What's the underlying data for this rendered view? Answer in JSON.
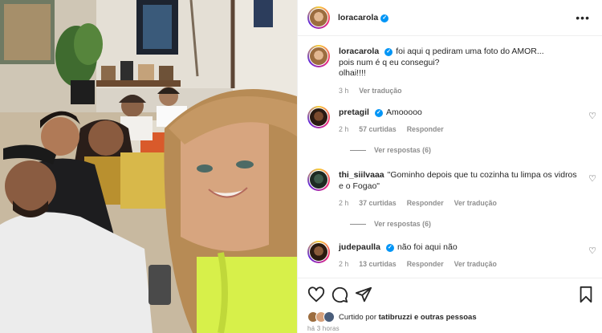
{
  "post": {
    "username": "loracarola",
    "caption": {
      "line1": "foi aqui q pediram uma foto do AMOR...",
      "line2": "pois num é q eu consegui?",
      "line3": "olhai!!!!",
      "time": "3 h",
      "translate": "Ver tradução"
    }
  },
  "comments": [
    {
      "username": "pretagil",
      "text": "Amooooo",
      "time": "2 h",
      "likes": "57 curtidas",
      "reply": "Responder",
      "translate": "",
      "view_replies": "Ver respostas (6)"
    },
    {
      "username": "thi_siilvaaa",
      "text_line1": "\"Gominho depois que tu cozinha tu limpa os vidros",
      "text_line2": "e o Fogao\"",
      "time": "2 h",
      "likes": "37 curtidas",
      "reply": "Responder",
      "translate": "Ver tradução",
      "view_replies": "Ver respostas (6)"
    },
    {
      "username": "judepaulla",
      "text": "não foi aqui não",
      "time": "2 h",
      "likes": "13 curtidas",
      "reply": "Responder",
      "translate": "Ver tradução"
    }
  ],
  "footer": {
    "liked_prefix": "Curtido por",
    "liked_user": "tatibruzzi",
    "liked_suffix": "e outras pessoas",
    "timestamp": "há 3 horas"
  },
  "icons": {
    "more": "more-options-icon",
    "heart": "heart-icon",
    "comment": "comment-icon",
    "share": "share-icon",
    "save": "bookmark-icon",
    "verified": "verified-badge-icon"
  },
  "colors": {
    "accent": "#0095f6",
    "muted": "#8e8e8e",
    "text": "#262626"
  }
}
